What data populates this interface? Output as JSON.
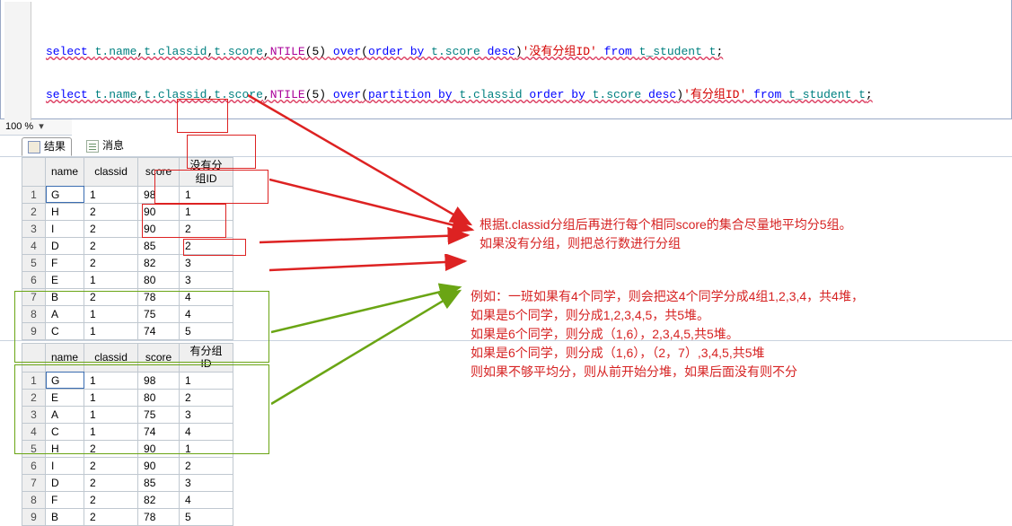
{
  "editor": {
    "line1": {
      "kw_select": "select ",
      "id_name": "t.name",
      "comma1": ",",
      "id_classid": "t.classid",
      "comma2": ",",
      "id_score": "t.score",
      "comma3": ",",
      "fn_ntile": "NTILE",
      "args": "(5) ",
      "kw_over": "over",
      "paren_open": "(",
      "kw_orderby": "order by",
      "id_score2": " t.score ",
      "kw_desc": "desc",
      "paren_close": ")",
      "str": "'没有分组ID'",
      "kw_from": " from ",
      "id_table": "t_student t",
      "semi": ";"
    },
    "line2": {
      "kw_select": "select ",
      "id_name": "t.name",
      "comma1": ",",
      "id_classid": "t.classid",
      "comma2": ",",
      "id_score": "t.score",
      "comma3": ",",
      "fn_ntile": "NTILE",
      "args": "(5) ",
      "kw_over": "over",
      "paren_open": "(",
      "kw_partby": "partition by ",
      "id_partcol": "t.classid",
      "kw_orderby": " order by",
      "id_score2": " t.score ",
      "kw_desc": "desc",
      "paren_close": ")",
      "str": "'有分组ID'",
      "kw_from": " from ",
      "id_table": "t_student t",
      "semi": ";"
    }
  },
  "zoom": "100 %",
  "tabs": {
    "results": "结果",
    "messages": "消息"
  },
  "headers": {
    "name": "name",
    "classid": "classid",
    "score": "score",
    "col4a": "没有分组ID",
    "col4b": "有分组ID"
  },
  "grid1": [
    {
      "r": "1",
      "name": "G",
      "classid": "1",
      "score": "98",
      "g": "1"
    },
    {
      "r": "2",
      "name": "H",
      "classid": "2",
      "score": "90",
      "g": "1"
    },
    {
      "r": "3",
      "name": "I",
      "classid": "2",
      "score": "90",
      "g": "2"
    },
    {
      "r": "4",
      "name": "D",
      "classid": "2",
      "score": "85",
      "g": "2"
    },
    {
      "r": "5",
      "name": "F",
      "classid": "2",
      "score": "82",
      "g": "3"
    },
    {
      "r": "6",
      "name": "E",
      "classid": "1",
      "score": "80",
      "g": "3"
    },
    {
      "r": "7",
      "name": "B",
      "classid": "2",
      "score": "78",
      "g": "4"
    },
    {
      "r": "8",
      "name": "A",
      "classid": "1",
      "score": "75",
      "g": "4"
    },
    {
      "r": "9",
      "name": "C",
      "classid": "1",
      "score": "74",
      "g": "5"
    }
  ],
  "grid2": [
    {
      "r": "1",
      "name": "G",
      "classid": "1",
      "score": "98",
      "g": "1"
    },
    {
      "r": "2",
      "name": "E",
      "classid": "1",
      "score": "80",
      "g": "2"
    },
    {
      "r": "3",
      "name": "A",
      "classid": "1",
      "score": "75",
      "g": "3"
    },
    {
      "r": "4",
      "name": "C",
      "classid": "1",
      "score": "74",
      "g": "4"
    },
    {
      "r": "5",
      "name": "H",
      "classid": "2",
      "score": "90",
      "g": "1"
    },
    {
      "r": "6",
      "name": "I",
      "classid": "2",
      "score": "90",
      "g": "2"
    },
    {
      "r": "7",
      "name": "D",
      "classid": "2",
      "score": "85",
      "g": "3"
    },
    {
      "r": "8",
      "name": "F",
      "classid": "2",
      "score": "82",
      "g": "4"
    },
    {
      "r": "9",
      "name": "B",
      "classid": "2",
      "score": "78",
      "g": "5"
    }
  ],
  "annotations": {
    "top_note": "根据t.classid分组后再进行每个相同score的集合尽量地平均分5组。\n如果没有分组，则把总行数进行分组",
    "bottom_note": "例如：一班如果有4个同学，则会把这4个同学分成4组1,2,3,4，共4堆，\n如果是5个同学，则分成1,2,3,4,5，共5堆。\n如果是6个同学，则分成（1,6），2,3,4,5,共5堆。\n如果是6个同学，则分成（1,6），（2，7）,3,4,5,共5堆\n则如果不够平均分，则从前开始分堆，如果后面没有则不分"
  }
}
